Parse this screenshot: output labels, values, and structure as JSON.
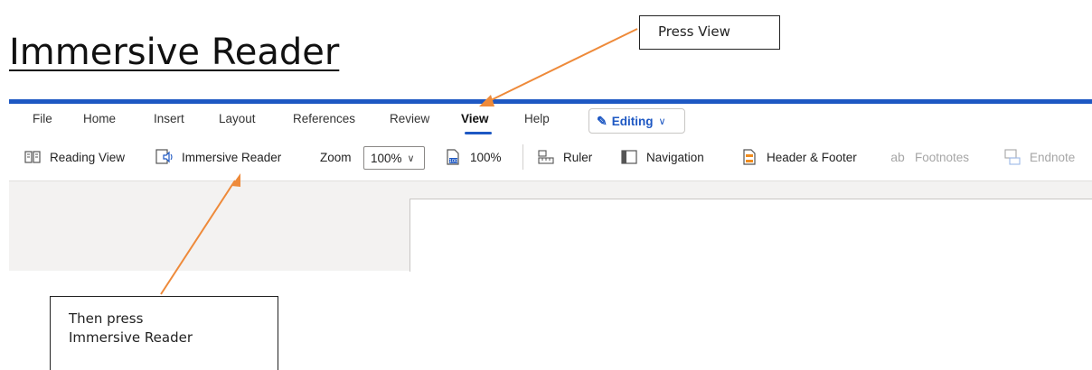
{
  "title": "Immersive Reader",
  "callouts": {
    "top": "Press View",
    "bottom_line1": "Then press",
    "bottom_line2": "Immersive Reader"
  },
  "menu_tabs": [
    "File",
    "Home",
    "Insert",
    "Layout",
    "References",
    "Review",
    "View",
    "Help"
  ],
  "active_tab": "View",
  "editing_button": {
    "label": "Editing",
    "icon": "pencil-icon"
  },
  "commands": {
    "reading_view": "Reading View",
    "immersive_reader": "Immersive Reader",
    "zoom_label": "Zoom",
    "zoom_value": "100%",
    "hundred_percent": "100%",
    "ruler": "Ruler",
    "navigation": "Navigation",
    "header_footer": "Header & Footer",
    "footnotes": "Footnotes",
    "endnotes": "Endnote"
  },
  "colors": {
    "accent": "#1e58c3",
    "arrow": "#ee8a3a",
    "header_footer_icon": "#f08c1e"
  }
}
